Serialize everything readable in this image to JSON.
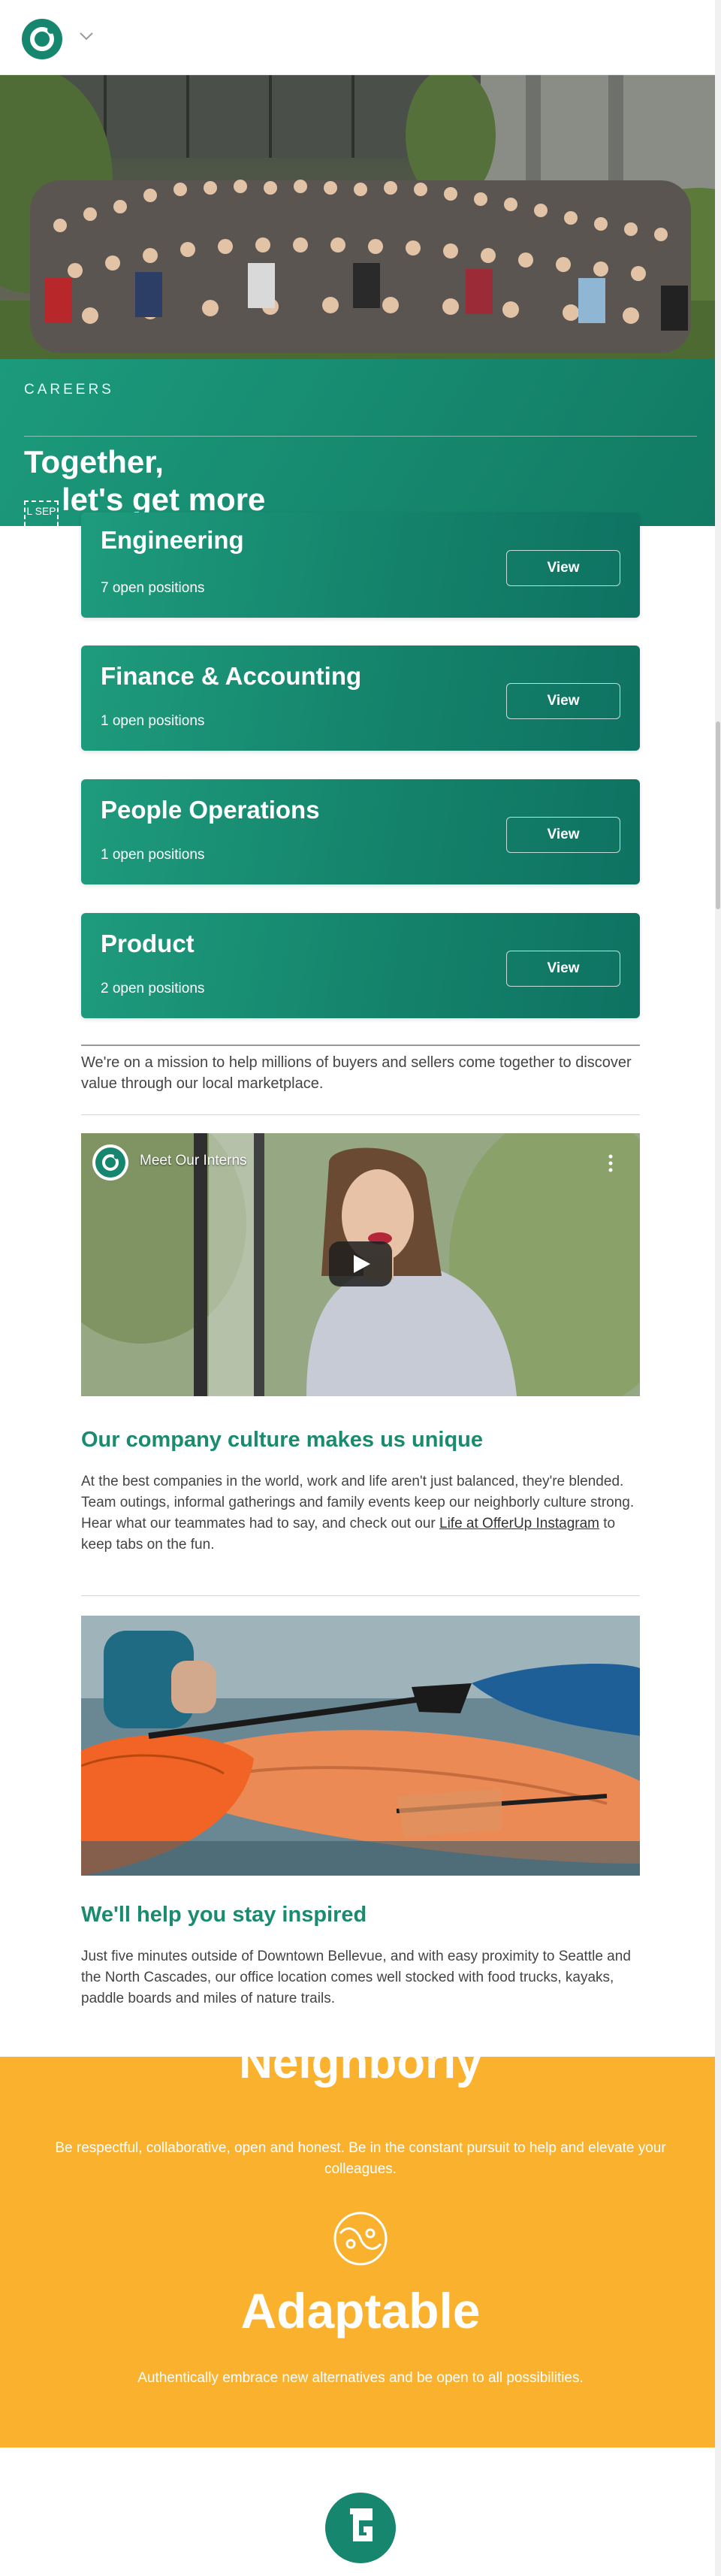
{
  "header": {
    "logo": "offerup-logo-icon",
    "menu_icon": "chevron-down-icon"
  },
  "hero": {
    "photo_icon": "group-photo",
    "careers_label": "CAREERS",
    "title_line1": "Together,",
    "sep_glyph": "L SEP",
    "title_line2": "let's get more"
  },
  "jobs": [
    {
      "title": "Engineering",
      "count": "7 open positions",
      "button": "View"
    },
    {
      "title": "Finance & Accounting",
      "count": "1 open positions",
      "button": "View"
    },
    {
      "title": "People Operations",
      "count": "1 open positions",
      "button": "View"
    },
    {
      "title": "Product",
      "count": "2 open positions",
      "button": "View"
    }
  ],
  "mission": "We're on a mission to help millions of buyers and sellers come together to discover value through our local marketplace.",
  "video": {
    "title": "Meet Our Interns",
    "play_icon": "play-icon",
    "menu_icon": "more-vertical-icon"
  },
  "culture": {
    "heading": "Our company culture makes us unique",
    "text_before": "At the best companies in the world, work and life aren't just balanced, they're blended. Team outings, informal gatherings and family events keep our neighborly culture strong. Hear what our teammates had to say, and check out our ",
    "link": "Life at OfferUp Instagram",
    "text_after": " to keep tabs on the fun."
  },
  "inspired": {
    "heading": "We'll help you stay inspired",
    "text": "Just five minutes outside of Downtown Bellevue, and with easy proximity to Seattle and the North Cascades, our office location comes well stocked with food trucks, kayaks, paddle boards and miles of nature trails."
  },
  "values": {
    "color": "#f9b12e",
    "neighborly_title": "Neighborly",
    "neighborly_desc": "Be respectful, collaborative, open and honest. Be in the constant pursuit to help and elevate your colleagues.",
    "adaptable_icon": "yin-yang-icon",
    "adaptable_title": "Adaptable",
    "adaptable_desc": "Authentically embrace new alternatives and be open to all possibilities."
  },
  "footer": {
    "logo": "offerup-badge-icon"
  },
  "colors": {
    "brand_green": "#1a8a70",
    "band_yellow": "#f9b12e"
  }
}
